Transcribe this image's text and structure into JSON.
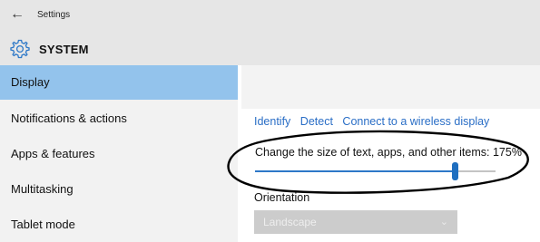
{
  "window": {
    "title": "Settings",
    "back_icon": "back-arrow-icon"
  },
  "header": {
    "icon": "gear-icon",
    "title": "SYSTEM"
  },
  "sidebar": {
    "items": [
      {
        "label": "Display",
        "active": true
      },
      {
        "label": "Notifications & actions",
        "active": false
      },
      {
        "label": "Apps & features",
        "active": false
      },
      {
        "label": "Multitasking",
        "active": false
      },
      {
        "label": "Tablet mode",
        "active": false
      }
    ]
  },
  "main": {
    "links": [
      "Identify",
      "Detect",
      "Connect to a wireless display"
    ],
    "scale": {
      "label": "Change the size of text, apps, and other items: 175%",
      "slider_fraction": 0.83
    },
    "orientation": {
      "label": "Orientation",
      "value": "Landscape"
    }
  },
  "colors": {
    "active_nav": "#93c3ec",
    "link": "#2a6ec6",
    "slider": "#2d78c8",
    "annotation": "#000000"
  }
}
